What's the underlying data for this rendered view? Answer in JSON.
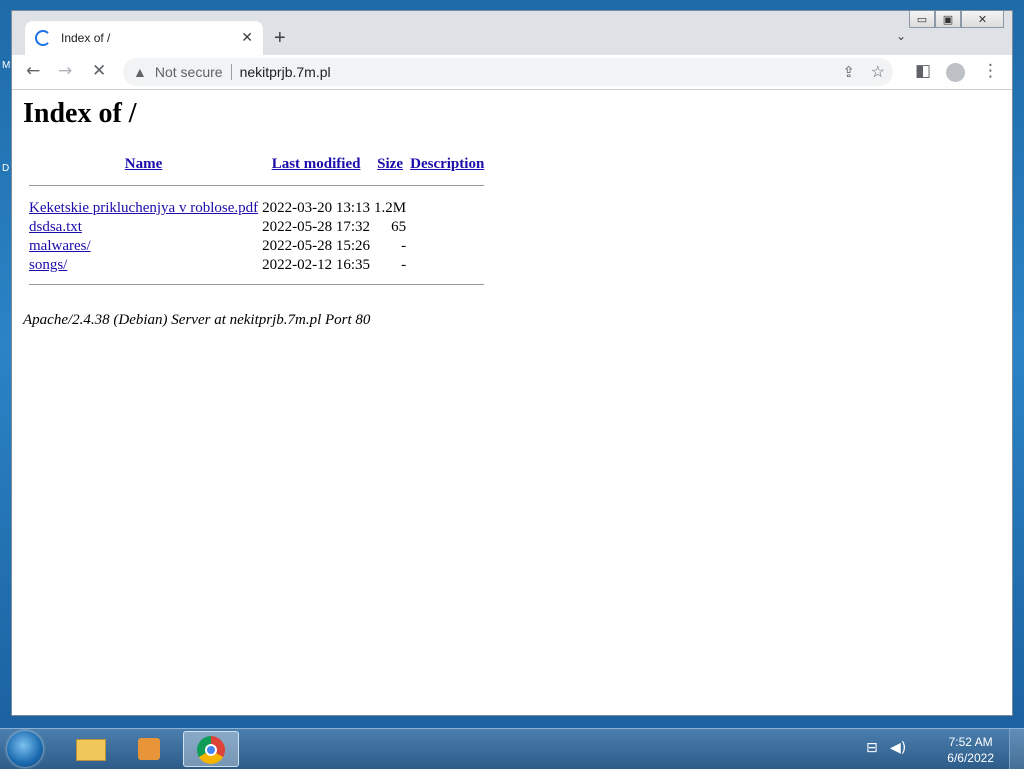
{
  "desktop": {
    "hint1": "M",
    "hint2": "D"
  },
  "window": {
    "minimize": "▭",
    "maximize": "▣",
    "close": "✕"
  },
  "tab": {
    "title": "Index of /",
    "close": "✕",
    "new_tab": "+",
    "tab_search": "⌄"
  },
  "toolbar": {
    "back": "←",
    "forward": "→",
    "reload": "✕",
    "security_warning": "▲",
    "security_label": "Not secure",
    "url": "nekitprjb.7m.pl",
    "share": "⇪",
    "bookmark": "☆",
    "side_panel": "◧",
    "menu": "⋮"
  },
  "page": {
    "heading": "Index of /",
    "columns": {
      "name": "Name",
      "last_modified": "Last modified",
      "size": "Size",
      "description": "Description"
    },
    "rows": [
      {
        "name": "Keketskie prikluchenjya v roblose.pdf",
        "modified": "2022-03-20 13:13",
        "size": "1.2M",
        "description": ""
      },
      {
        "name": "dsdsa.txt",
        "modified": "2022-05-28 17:32",
        "size": "65",
        "description": ""
      },
      {
        "name": "malwares/",
        "modified": "2022-05-28 15:26",
        "size": "-",
        "description": ""
      },
      {
        "name": "songs/",
        "modified": "2022-02-12 16:35",
        "size": "-",
        "description": ""
      }
    ],
    "footer": "Apache/2.4.38 (Debian) Server at nekitprjb.7m.pl Port 80"
  },
  "taskbar": {
    "tray_network": "⊟",
    "tray_volume": "◀)",
    "time": "7:52 AM",
    "date": "6/6/2022"
  },
  "colors": {
    "link": "#1a0dab",
    "accent": "#1a73e8"
  }
}
